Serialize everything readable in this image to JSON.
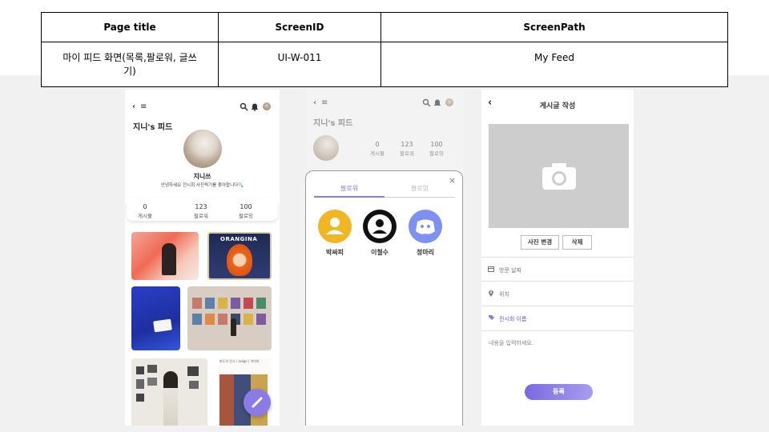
{
  "spec_table": {
    "headers": {
      "page_title": "Page title",
      "screen_id": "ScreenID",
      "screen_path": "ScreenPath"
    },
    "values": {
      "page_title": "마이 피드 화면(목록,팔로워, 글쓰기)",
      "screen_id": "UI-W-011",
      "screen_path": "My Feed"
    }
  },
  "screen1": {
    "feed_title": "지니's 피드",
    "username": "지니쓰",
    "bio": "안녕하세요 전시회 사진찍기를 좋아합니다🔍",
    "stats": [
      {
        "count": "0",
        "label": "게시물"
      },
      {
        "count": "123",
        "label": "팔로워"
      },
      {
        "count": "100",
        "label": "팔로잉"
      }
    ],
    "photo_texts": {
      "orangina": "ORANGINA",
      "photo_caption": "파도의 전시 / lodge / 이미지"
    }
  },
  "screen2": {
    "feed_title": "지니's 피드",
    "stats": [
      {
        "count": "0",
        "label": "게시물"
      },
      {
        "count": "123",
        "label": "팔로워"
      },
      {
        "count": "100",
        "label": "팔로잉"
      }
    ],
    "tabs": [
      {
        "label": "팔로워"
      },
      {
        "label": "팔로잉"
      }
    ],
    "close": "×",
    "followers": [
      {
        "name": "박싸피"
      },
      {
        "name": "이철수"
      },
      {
        "name": "정마리"
      }
    ]
  },
  "screen3": {
    "back": "‹",
    "title": "게시글 작성",
    "change_photo": "사진 변경",
    "delete": "삭제",
    "fields": [
      {
        "label": "방문 날짜",
        "icon": "calendar-icon"
      },
      {
        "label": "위치",
        "icon": "location-icon"
      },
      {
        "label": "전시회 이름",
        "icon": "tag-icon"
      }
    ],
    "content_placeholder": "내용을 입력하세요.",
    "submit": "등록"
  },
  "colors": {
    "accent": "#8a7be6",
    "accent_light": "#b9aef2"
  }
}
